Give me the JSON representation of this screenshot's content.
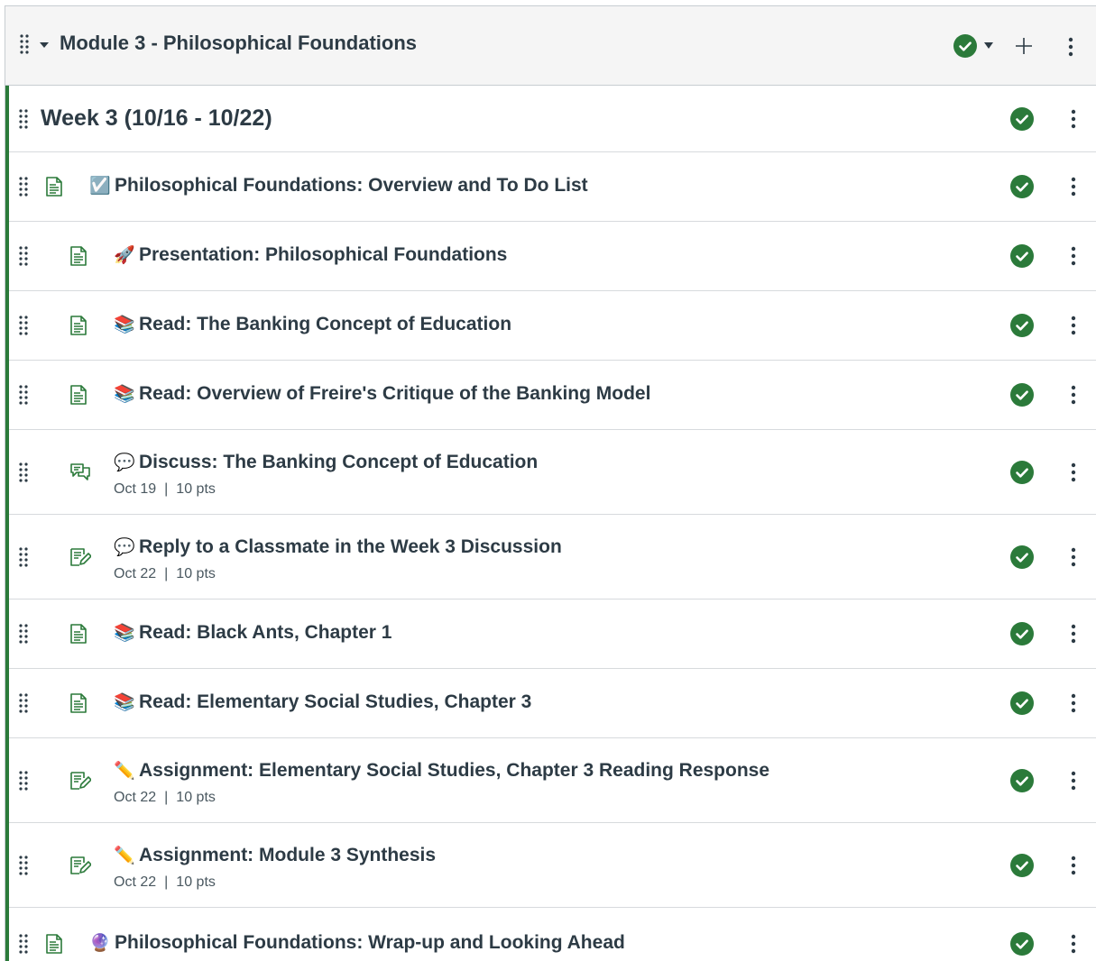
{
  "module": {
    "title": "Module 3 - Philosophical Foundations",
    "published_icon": "check-circle-icon",
    "accent_color": "#2b7a3a"
  },
  "items": [
    {
      "kind": "header",
      "title": "Week 3 (10/16 - 10/22)"
    },
    {
      "kind": "page",
      "emoji": "☑️",
      "icon": "page-icon",
      "title": "Philosophical Foundations: Overview and To Do List",
      "indent": 0
    },
    {
      "kind": "page",
      "emoji": "🚀",
      "icon": "page-icon",
      "title": "Presentation: Philosophical Foundations",
      "indent": 1
    },
    {
      "kind": "page",
      "emoji": "📚",
      "icon": "page-icon",
      "title": "Read: The Banking Concept of Education",
      "indent": 1
    },
    {
      "kind": "page",
      "emoji": "📚",
      "icon": "page-icon",
      "title": "Read: Overview of Freire's Critique of the Banking Model",
      "indent": 1
    },
    {
      "kind": "discussion",
      "emoji": "💬",
      "icon": "discussion-icon",
      "title": "Discuss: The Banking Concept of Education",
      "date": "Oct 19",
      "points": "10 pts",
      "indent": 1
    },
    {
      "kind": "assignment",
      "emoji": "💬",
      "icon": "assignment-icon",
      "title": "Reply to a Classmate in the Week 3 Discussion",
      "date": "Oct 22",
      "points": "10 pts",
      "indent": 1
    },
    {
      "kind": "page",
      "emoji": "📚",
      "icon": "page-icon",
      "title": "Read: Black Ants, Chapter 1",
      "indent": 1
    },
    {
      "kind": "page",
      "emoji": "📚",
      "icon": "page-icon",
      "title": "Read: Elementary Social Studies, Chapter 3",
      "indent": 1
    },
    {
      "kind": "assignment",
      "emoji": "✏️",
      "icon": "assignment-icon",
      "title": "Assignment: Elementary Social Studies, Chapter 3 Reading Response",
      "date": "Oct 22",
      "points": "10 pts",
      "indent": 1
    },
    {
      "kind": "assignment",
      "emoji": "✏️",
      "icon": "assignment-icon",
      "title": "Assignment: Module 3 Synthesis",
      "date": "Oct 22",
      "points": "10 pts",
      "indent": 1
    },
    {
      "kind": "page",
      "emoji": "🔮",
      "icon": "page-icon",
      "title": "Philosophical Foundations: Wrap-up and Looking Ahead",
      "indent": 0
    }
  ]
}
